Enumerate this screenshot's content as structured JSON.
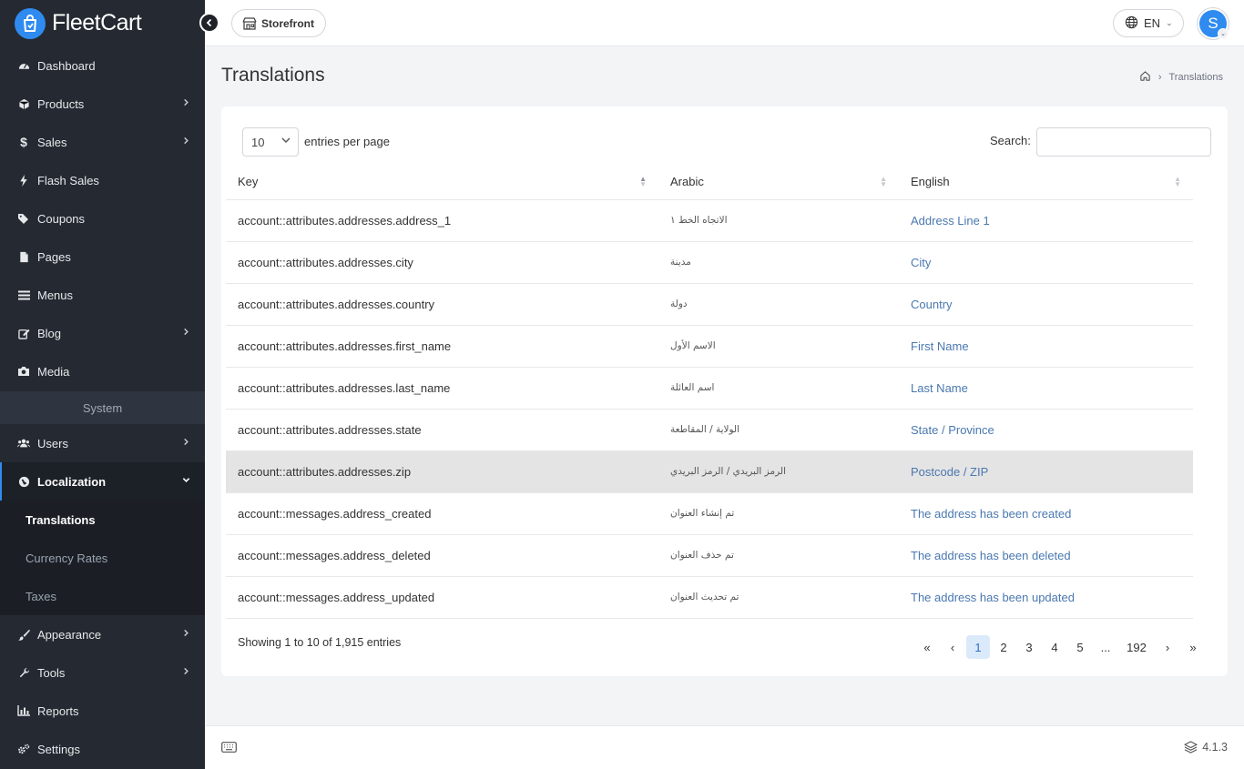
{
  "brand": {
    "name": "FleetCart"
  },
  "sidebar": {
    "items": [
      {
        "label": "Dashboard",
        "icon": "dashboard-icon",
        "has_children": false
      },
      {
        "label": "Products",
        "icon": "cube-icon",
        "has_children": true
      },
      {
        "label": "Sales",
        "icon": "dollar-icon",
        "has_children": true
      },
      {
        "label": "Flash Sales",
        "icon": "bolt-icon",
        "has_children": false
      },
      {
        "label": "Coupons",
        "icon": "tags-icon",
        "has_children": false
      },
      {
        "label": "Pages",
        "icon": "file-icon",
        "has_children": false
      },
      {
        "label": "Menus",
        "icon": "bars-icon",
        "has_children": false
      },
      {
        "label": "Blog",
        "icon": "edit-icon",
        "has_children": true
      },
      {
        "label": "Media",
        "icon": "camera-icon",
        "has_children": false
      }
    ],
    "section_label": "System",
    "system_items": [
      {
        "label": "Users",
        "icon": "users-icon",
        "has_children": true
      },
      {
        "label": "Localization",
        "icon": "globe-icon",
        "has_children": true,
        "expanded": true
      }
    ],
    "localization_children": [
      {
        "label": "Translations",
        "active": true
      },
      {
        "label": "Currency Rates",
        "active": false
      },
      {
        "label": "Taxes",
        "active": false
      }
    ],
    "bottom_items": [
      {
        "label": "Appearance",
        "icon": "brush-icon",
        "has_children": true
      },
      {
        "label": "Tools",
        "icon": "wrench-icon",
        "has_children": true
      },
      {
        "label": "Reports",
        "icon": "bar-chart-icon",
        "has_children": false
      },
      {
        "label": "Settings",
        "icon": "cogs-icon",
        "has_children": false
      }
    ]
  },
  "topbar": {
    "storefront_label": "Storefront",
    "language": "EN",
    "avatar_initial": "S"
  },
  "page": {
    "title": "Translations",
    "breadcrumb_current": "Translations"
  },
  "table_controls": {
    "page_length": "10",
    "length_label": "entries per page",
    "search_label": "Search:",
    "search_value": ""
  },
  "table": {
    "columns": [
      "Key",
      "Arabic",
      "English"
    ],
    "rows": [
      {
        "key": "account::attributes.addresses.address_1",
        "arabic": "الاتجاه الخط ١",
        "english": "Address Line 1"
      },
      {
        "key": "account::attributes.addresses.city",
        "arabic": "مدينة",
        "english": "City"
      },
      {
        "key": "account::attributes.addresses.country",
        "arabic": "دولة",
        "english": "Country"
      },
      {
        "key": "account::attributes.addresses.first_name",
        "arabic": "الاسم الأول",
        "english": "First Name"
      },
      {
        "key": "account::attributes.addresses.last_name",
        "arabic": "اسم العائلة",
        "english": "Last Name"
      },
      {
        "key": "account::attributes.addresses.state",
        "arabic": "الولاية / المقاطعة",
        "english": "State / Province"
      },
      {
        "key": "account::attributes.addresses.zip",
        "arabic": "الرمز البريدي / الرمز البريدي",
        "english": "Postcode / ZIP"
      },
      {
        "key": "account::messages.address_created",
        "arabic": "تم إنشاء العنوان",
        "english": "The address has been created"
      },
      {
        "key": "account::messages.address_deleted",
        "arabic": "تم حذف العنوان",
        "english": "The address has been deleted"
      },
      {
        "key": "account::messages.address_updated",
        "arabic": "تم تحديث العنوان",
        "english": "The address has been updated"
      }
    ],
    "highlighted_row": 6
  },
  "footer_info": "Showing 1 to 10 of 1,915 entries",
  "pagination": {
    "first": "«",
    "prev": "‹",
    "pages": [
      "1",
      "2",
      "3",
      "4",
      "5",
      "...",
      "192"
    ],
    "active_page": "1",
    "next": "›",
    "last": "»"
  },
  "footer": {
    "version": "4.1.3"
  },
  "colors": {
    "accent": "#2f8bf0",
    "sidebar_bg": "#252a32",
    "link": "#4a78b0"
  }
}
